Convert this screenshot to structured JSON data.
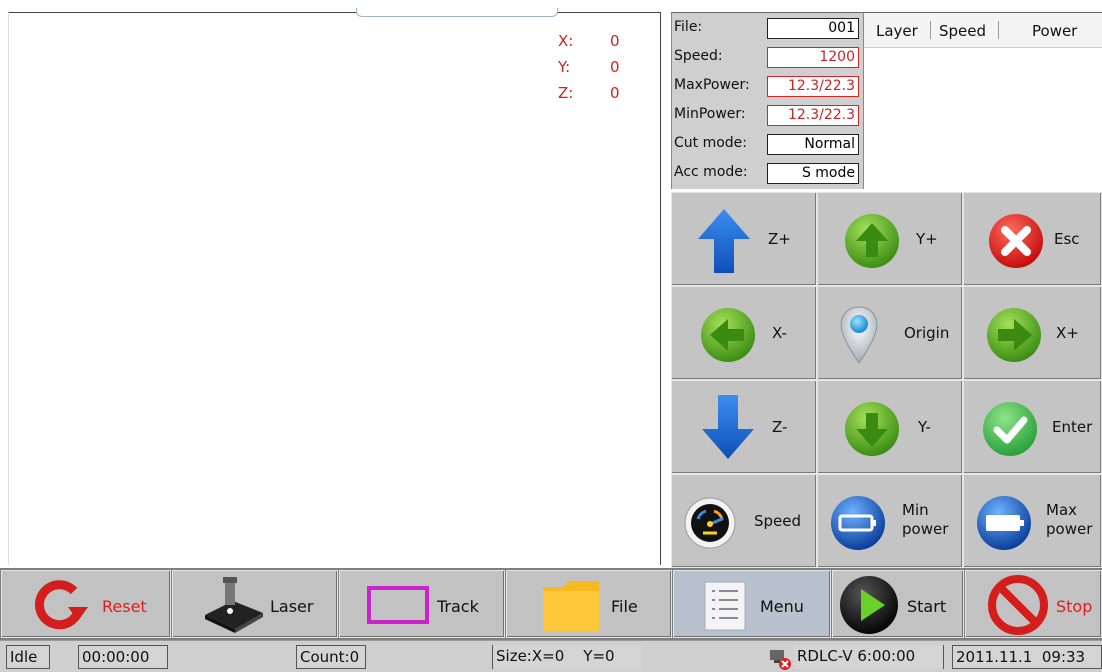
{
  "canvas": {
    "coords": [
      {
        "axis": "X:",
        "value": "0"
      },
      {
        "axis": "Y:",
        "value": "0"
      },
      {
        "axis": "Z:",
        "value": "0"
      }
    ]
  },
  "file_info": {
    "rows": [
      {
        "label": "File:",
        "value": "001",
        "highlight": false
      },
      {
        "label": "Speed:",
        "value": "1200",
        "highlight": true
      },
      {
        "label": "MaxPower:",
        "value": "12.3/22.3",
        "highlight": true
      },
      {
        "label": "MinPower:",
        "value": "12.3/22.3",
        "highlight": true
      },
      {
        "label": "Cut mode:",
        "value": "Normal",
        "highlight": false
      },
      {
        "label": "Acc mode:",
        "value": "S mode",
        "highlight": false
      }
    ]
  },
  "layer_table": {
    "headers": [
      "Layer",
      "Speed",
      "Power"
    ]
  },
  "jog": {
    "z_plus": "Z+",
    "y_plus": "Y+",
    "esc": "Esc",
    "x_minus": "X-",
    "origin": "Origin",
    "x_plus": "X+",
    "z_minus": "Z-",
    "y_minus": "Y-",
    "enter": "Enter",
    "speed": "Speed",
    "min_power_1": "Min",
    "min_power_2": "power",
    "max_power_1": "Max",
    "max_power_2": "power"
  },
  "toolbar": {
    "reset": "Reset",
    "laser": "Laser",
    "track": "Track",
    "file": "File",
    "menu": "Menu",
    "start": "Start",
    "stop": "Stop"
  },
  "status": {
    "state": "Idle",
    "time": "00:00:00",
    "count": "Count:0",
    "size": "Size:X=0    Y=0",
    "version": "RDLC-V 6:00:00",
    "datetime": "2011.11.1  09:33"
  },
  "colors": {
    "accent_red": "#cc2222",
    "arrow_blue": "#1f6fd6",
    "arrow_green": "#4aa21c",
    "esc_red": "#e0201c",
    "enter_green": "#3fb84a"
  }
}
